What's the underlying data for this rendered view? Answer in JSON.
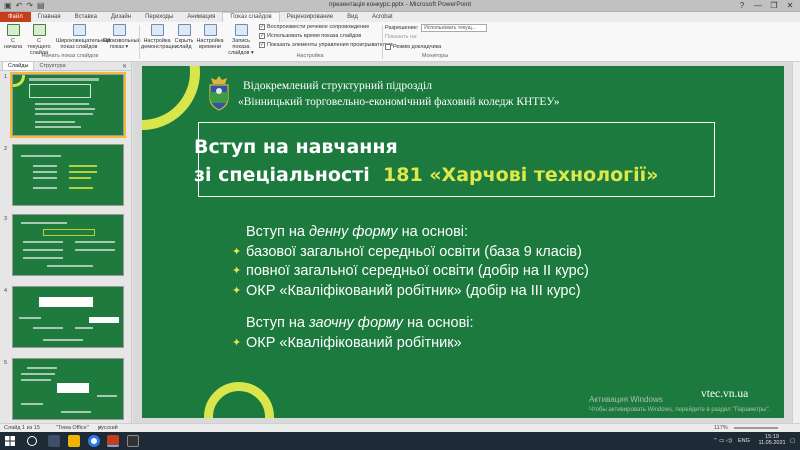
{
  "window": {
    "title": "презентація конкурс.pptx - Microsoft PowerPoint",
    "qat_icons": [
      "save-icon",
      "undo-icon",
      "redo-icon",
      "presentation-icon"
    ],
    "controls": [
      "?",
      "—",
      "❐",
      "✕"
    ]
  },
  "tabs": [
    "Файл",
    "Главная",
    "Вставка",
    "Дизайн",
    "Переходы",
    "Анимация",
    "Показ слайдов",
    "Рецензирование",
    "Вид",
    "Acrobat"
  ],
  "active_tab": "Показ слайдов",
  "ribbon": {
    "buttons": [
      {
        "label1": "С",
        "label2": "начала"
      },
      {
        "label1": "С текущего",
        "label2": "слайда"
      },
      {
        "label1": "Широковещательный",
        "label2": "показ слайдов"
      },
      {
        "label1": "Произвольный",
        "label2": "показ ▾"
      },
      {
        "label1": "Настройка",
        "label2": "демонстрации"
      },
      {
        "label1": "Скрыть",
        "label2": "слайд"
      },
      {
        "label1": "Настройка",
        "label2": "времени"
      },
      {
        "label1": "Запись показа",
        "label2": "слайдов ▾"
      }
    ],
    "group_start": "Начать показ слайдов",
    "group_setup": "Настройка",
    "group_monitors": "Мониторы",
    "checks": [
      {
        "label": "Воспроизвести речевое сопровождение",
        "checked": true
      },
      {
        "label": "Использовать время показа слайдов",
        "checked": true
      },
      {
        "label": "Показать элементы управления проигрывателем",
        "checked": true
      }
    ],
    "resolution_label": "Разрешение:",
    "resolution_value": "Использовать текущ...",
    "show_on_label": "Показать на:",
    "show_on_value": "",
    "presenter_view": "Режим докладчика"
  },
  "pane": {
    "tabs": [
      "Слайды",
      "Структура"
    ],
    "close": "✕",
    "thumbs": [
      "1",
      "2",
      "3",
      "4",
      "5"
    ]
  },
  "slide": {
    "org_line1": "Відокремлений структурний підрозділ",
    "org_line2": "«Вінницький торговельно-економічний фаховий коледж КНТЕУ»",
    "title_line1": "Вступ на навчання",
    "title_line2_a": "зі спеціальності",
    "title_line2_b": "181 «Харчові технології»",
    "day_intro_a": "Вступ на ",
    "day_intro_b": "денну форму",
    "day_intro_c": " на основі:",
    "day_items": [
      "базової загальної середньої освіти (база 9 класів)",
      "повної загальної середньої освіти (добір на ІІ курс)",
      "ОКР «Кваліфікований робітник» (добір на ІІІ курс)"
    ],
    "part_intro_a": "Вступ на ",
    "part_intro_b": "заочну форму",
    "part_intro_c": " на основі:",
    "part_items": [
      "ОКР «Кваліфікований робітник»"
    ],
    "bullet_mark": "✦",
    "site": "vtec.vn.ua"
  },
  "activation": {
    "line1": "Активация Windows",
    "line2": "Чтобы активировать Windows, перейдите в раздел \"Параметры\"."
  },
  "status": {
    "slide_info": "Слайд 1 из 15",
    "theme": "\"Тема Office\"",
    "language": "русский",
    "zoom": "117%"
  },
  "taskbar": {
    "lang": "ENG",
    "time": "15:19",
    "date": "11.05.2021"
  },
  "colors": {
    "slide_green": "#1c7a3e",
    "accent_yellow": "#d8e64c",
    "file_tab": "#c43e1c"
  }
}
